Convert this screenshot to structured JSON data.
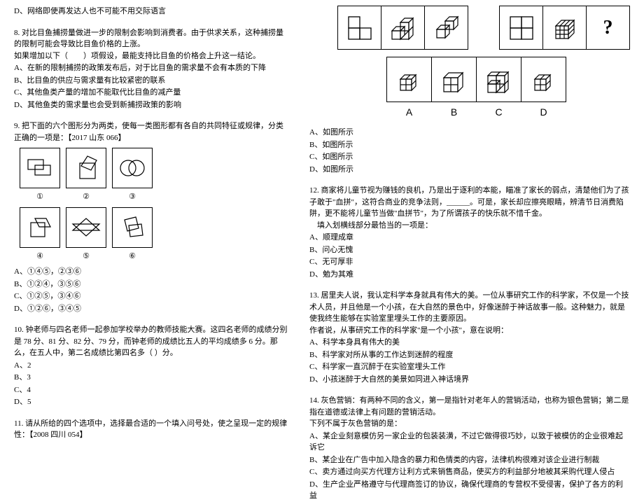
{
  "left": {
    "q7d": "D、网络即使再发达人也不可能不用交际语言",
    "q8": {
      "stem1": "8. 对比目鱼捕捞量做进一步的限制会影响到消费者。由于供求关系，这种捕捞量的限制可能会导致比目鱼价格的上涨。",
      "stem2": "如果增加以下（　　）项假设，最能支持比目鱼的价格会上升这一结论。",
      "a": "A、在新的限制捕捞的政策发布后，对于比目鱼的需求量不会有本质的下降",
      "b": "B、比目鱼的供应与需求量有比较紧密的联系",
      "c": "C、其他鱼类产量的增加不能取代比目鱼的减产量",
      "d": "D、其他鱼类的需求量也会受到新捕捞政策的影响"
    },
    "q9": {
      "stem": "9. 把下面的六个图形分为两类，使每一类图形都有各自的共同特征或规律，分类正确的一项是：【2017 山东 066】",
      "n1": "①",
      "n2": "②",
      "n3": "③",
      "n4": "④",
      "n5": "⑤",
      "n6": "⑥",
      "a": "A、①④⑤，②③⑥",
      "b": "B、①②④，③⑤⑥",
      "c": "C、①②⑤，③④⑥",
      "d": "D、①②⑥，③④⑤"
    },
    "q10": {
      "stem": "10. 钟老师与四名老师一起参加学校举办的教师技能大赛。这四名老师的成绩分别是 78 分、81 分、82 分、79 分，而钟老师的成绩比五人的平均成绩多 6 分。那么，在五人中，第二名成绩比第四名多（ ）分。",
      "a": "A、2",
      "b": "B、3",
      "c": "C、4",
      "d": "D、5"
    },
    "q11": {
      "stem": "11. 请从所给的四个选项中，选择最合适的一个填入问号处，使之呈现一定的规律性：【2008 四川 054】"
    }
  },
  "right": {
    "labels": {
      "A": "A",
      "B": "B",
      "C": "C",
      "D": "D"
    },
    "q11opts": {
      "a": "A、如图所示",
      "b": "B、如图所示",
      "c": "C、如图所示",
      "d": "D、如图所示"
    },
    "q12": {
      "stem1": "12. 商家将儿童节视为赚钱的良机，乃是出于逐利的本能，瞄准了家长的弱点，清楚他们为了孩子敢于\"血拼\"，这符合商业的竞争法则，______。可是，家长却应擦亮眼睛，辨清节日消费陷阱，更不能将儿童节当做\"血拼节\"，为了所谓孩子的快乐就不惜千金。",
      "stem2": "　填入划横线部分最恰当的一项是：",
      "a": "A、顺理成章",
      "b": "B、问心无愧",
      "c": "C、无可厚非",
      "d": "D、勉为其难"
    },
    "q13": {
      "stem1": "13. 居里夫人说，我认定科学本身就具有伟大的美。一位从事研究工作的科学家，不仅是一个技术人员，并且他是一个小孩，在大自然的景色中，好像迷醉于神话故事一般。这种魅力，就是使我终生能够在实验室里埋头工作的主要原因。",
      "stem2": "作者说，从事研究工作的科学家\"是一个小孩\"，意在说明：",
      "a": "A、科学本身具有伟大的美",
      "b": "B、科学家对所从事的工作达到迷醉的程度",
      "c": "C、科学家一直沉醉于在实验室埋头工作",
      "d": "D、小孩迷醉于大自然的美景如同进入神话境界"
    },
    "q14": {
      "stem1": "14. 灰色营销：有两种不同的含义，第一是指针对老年人的营销活动，也称为银色营销；第二是指在道德或法律上有问题的营销活动。",
      "stem2": "下列不属于灰色营销的是：",
      "a": "A、某企业刻意模仿另一家企业的包装装潢，不过它做得很巧妙，以致于被模仿的企业很难起诉它",
      "b": "B、某企业在广告中加入隐含的暴力和色情类的内容，法律机构很难对该企业进行制裁",
      "c": "C、卖方通过向买方代理方让利方式来销售商品，使买方的利益部分地被其采购代理人侵占",
      "d": "D、生产企业严格遵守与代理商签订的协议，确保代理商的专营权不受侵害，保护了各方的利益"
    }
  }
}
